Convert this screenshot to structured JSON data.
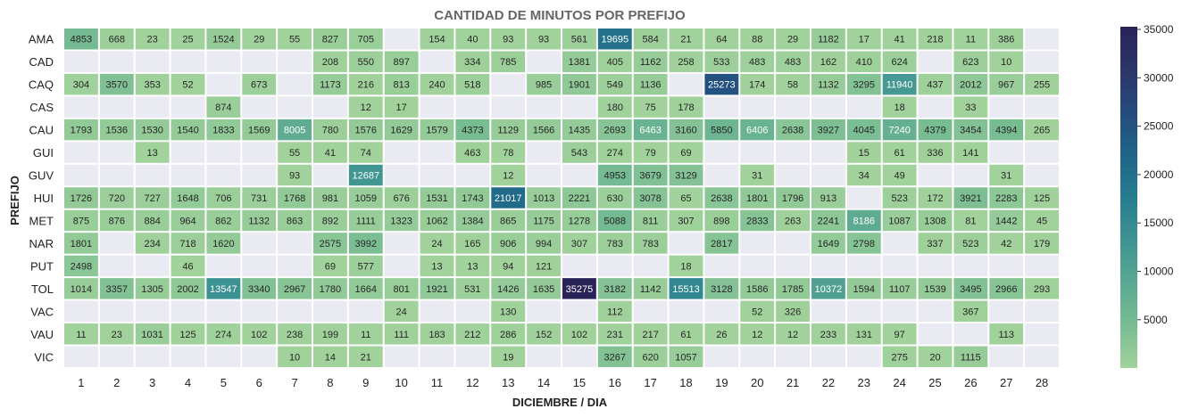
{
  "chart_data": {
    "type": "heatmap",
    "title": "CANTIDAD DE MINUTOS POR PREFIJO",
    "xlabel": "DICIEMBRE / DIA",
    "ylabel": "PREFIJO",
    "x": [
      "1",
      "2",
      "3",
      "4",
      "5",
      "6",
      "7",
      "8",
      "9",
      "10",
      "11",
      "12",
      "13",
      "14",
      "15",
      "16",
      "17",
      "18",
      "19",
      "20",
      "21",
      "22",
      "23",
      "24",
      "25",
      "26",
      "27",
      "28"
    ],
    "y": [
      "AMA",
      "CAD",
      "CAQ",
      "CAS",
      "CAU",
      "GUI",
      "GUV",
      "HUI",
      "MET",
      "NAR",
      "PUT",
      "TOL",
      "VAC",
      "VAU",
      "VIC"
    ],
    "values": [
      [
        4853,
        668,
        23,
        25,
        1524,
        29,
        55,
        827,
        705,
        null,
        154,
        40,
        93,
        93,
        561,
        19695,
        584,
        21,
        64,
        88,
        29,
        1182,
        17,
        41,
        218,
        11,
        386,
        null
      ],
      [
        null,
        null,
        null,
        null,
        null,
        null,
        null,
        208,
        550,
        897,
        null,
        334,
        785,
        null,
        1381,
        405,
        1162,
        258,
        533,
        483,
        483,
        162,
        410,
        624,
        null,
        623,
        10,
        null
      ],
      [
        304,
        3570,
        353,
        52,
        null,
        673,
        null,
        1173,
        216,
        813,
        240,
        518,
        null,
        985,
        1901,
        549,
        1136,
        null,
        25273,
        174,
        58,
        1132,
        3295,
        11940,
        437,
        2012,
        967,
        255
      ],
      [
        null,
        null,
        null,
        null,
        874,
        null,
        null,
        null,
        12,
        17,
        null,
        null,
        null,
        null,
        null,
        180,
        75,
        178,
        null,
        null,
        null,
        null,
        null,
        18,
        null,
        33,
        null,
        null
      ],
      [
        1793,
        1536,
        1530,
        1540,
        1833,
        1569,
        8005,
        780,
        1576,
        1629,
        1579,
        4373,
        1129,
        1566,
        1435,
        2693,
        6463,
        3160,
        5850,
        6406,
        2638,
        3927,
        4045,
        7240,
        4379,
        3454,
        4394,
        265
      ],
      [
        null,
        null,
        13,
        null,
        null,
        null,
        55,
        41,
        74,
        null,
        null,
        463,
        78,
        null,
        543,
        274,
        79,
        69,
        null,
        null,
        null,
        null,
        15,
        61,
        336,
        141,
        null,
        null
      ],
      [
        null,
        null,
        null,
        null,
        null,
        null,
        93,
        null,
        12687,
        null,
        null,
        null,
        12,
        null,
        null,
        4953,
        3679,
        3129,
        null,
        31,
        null,
        null,
        34,
        49,
        null,
        null,
        31,
        null
      ],
      [
        1726,
        720,
        727,
        1648,
        706,
        731,
        1768,
        981,
        1059,
        676,
        1531,
        1743,
        21017,
        1013,
        2221,
        630,
        3078,
        65,
        2638,
        1801,
        1796,
        913,
        null,
        523,
        172,
        3921,
        2283,
        125
      ],
      [
        875,
        876,
        884,
        964,
        862,
        1132,
        863,
        892,
        1111,
        1323,
        1062,
        1384,
        865,
        1175,
        1278,
        5088,
        811,
        307,
        898,
        2833,
        263,
        2241,
        8186,
        1087,
        1308,
        81,
        1442,
        45
      ],
      [
        1801,
        null,
        234,
        718,
        1620,
        null,
        null,
        2575,
        3992,
        null,
        24,
        165,
        906,
        994,
        307,
        783,
        783,
        null,
        2817,
        null,
        null,
        1649,
        2798,
        null,
        337,
        523,
        42,
        179
      ],
      [
        2498,
        null,
        null,
        46,
        null,
        null,
        null,
        69,
        577,
        null,
        13,
        13,
        94,
        121,
        null,
        null,
        null,
        18,
        null,
        null,
        null,
        null,
        null,
        null,
        null,
        null,
        null,
        null
      ],
      [
        1014,
        3357,
        1305,
        2002,
        13547,
        3340,
        2967,
        1780,
        1664,
        801,
        1921,
        531,
        1426,
        1635,
        35275,
        3182,
        1142,
        15513,
        3128,
        1586,
        1785,
        10372,
        1594,
        1107,
        1539,
        3495,
        2966,
        293
      ],
      [
        null,
        null,
        null,
        null,
        null,
        null,
        null,
        null,
        null,
        24,
        null,
        null,
        130,
        null,
        null,
        112,
        null,
        null,
        null,
        52,
        326,
        null,
        null,
        null,
        null,
        367,
        null,
        null
      ],
      [
        11,
        23,
        1031,
        125,
        274,
        102,
        238,
        199,
        11,
        111,
        183,
        212,
        286,
        152,
        102,
        231,
        217,
        61,
        26,
        12,
        12,
        233,
        131,
        97,
        null,
        null,
        113,
        null
      ],
      [
        null,
        null,
        null,
        null,
        null,
        null,
        10,
        14,
        21,
        null,
        null,
        null,
        19,
        null,
        null,
        3267,
        620,
        1057,
        null,
        null,
        null,
        null,
        null,
        275,
        20,
        1115,
        null,
        null
      ]
    ],
    "colorbar": {
      "ticks": [
        5000,
        10000,
        15000,
        20000,
        25000,
        30000,
        35000
      ],
      "min": 10,
      "max": 35275,
      "colormap": [
        "#a2d29b",
        "#78bc92",
        "#5aa892",
        "#3e9392",
        "#267d90",
        "#1f6488",
        "#254b7d",
        "#2b3569",
        "#2a2358"
      ]
    },
    "empty_cell_color": "#eaeaf2",
    "grid": false
  }
}
